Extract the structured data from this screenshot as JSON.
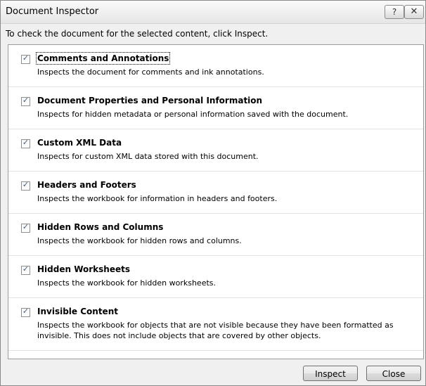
{
  "window": {
    "title": "Document Inspector",
    "help_glyph": "?",
    "close_glyph": "✕"
  },
  "instruction": "To check the document for the selected content, click Inspect.",
  "items": [
    {
      "checked": true,
      "title": "Comments and Annotations",
      "description": "Inspects the document for comments and ink annotations."
    },
    {
      "checked": true,
      "title": "Document Properties and Personal Information",
      "description": "Inspects for hidden metadata or personal information saved with the document."
    },
    {
      "checked": true,
      "title": "Custom XML Data",
      "description": "Inspects for custom XML data stored with this document."
    },
    {
      "checked": true,
      "title": "Headers and Footers",
      "description": "Inspects the workbook for information in headers and footers."
    },
    {
      "checked": true,
      "title": "Hidden Rows and Columns",
      "description": "Inspects the workbook for hidden rows and columns."
    },
    {
      "checked": true,
      "title": "Hidden Worksheets",
      "description": "Inspects the workbook for hidden worksheets."
    },
    {
      "checked": true,
      "title": "Invisible Content",
      "description": "Inspects the workbook for objects that are not visible because they have been formatted as invisible. This does not include objects that are covered by other objects."
    }
  ],
  "buttons": {
    "inspect_label": "Inspect",
    "close_label": "Close"
  }
}
